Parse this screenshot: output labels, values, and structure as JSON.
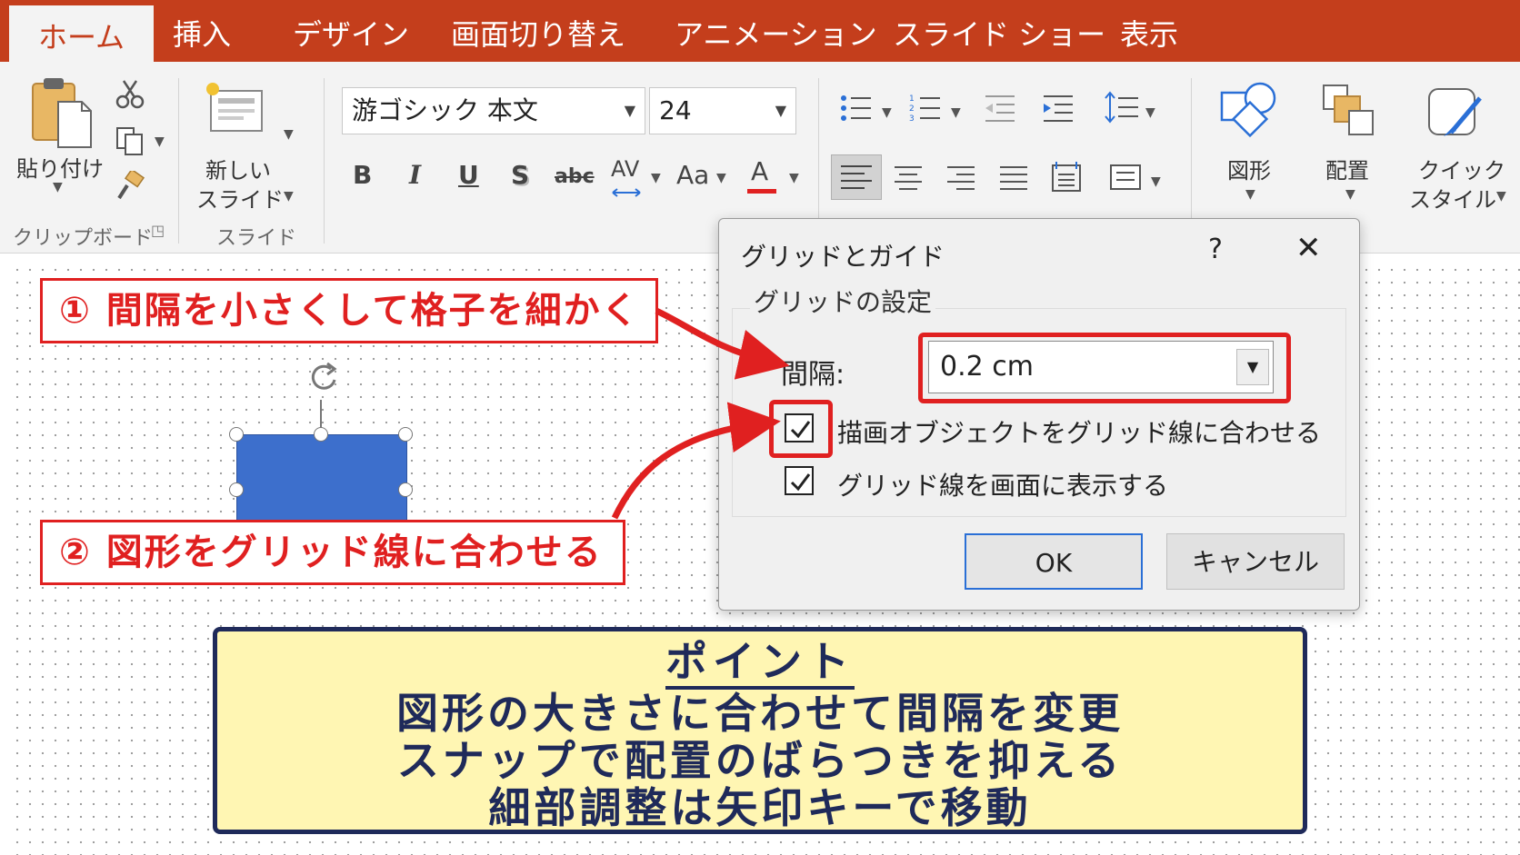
{
  "tabs": [
    {
      "label": "ホーム",
      "active": true
    },
    {
      "label": "挿入"
    },
    {
      "label": "デザイン"
    },
    {
      "label": "画面切り替え"
    },
    {
      "label": "アニメーション"
    },
    {
      "label": "スライド ショー"
    },
    {
      "label": "表示"
    }
  ],
  "ribbon": {
    "clipboard": {
      "paste_label": "貼り付け",
      "group_label": "クリップボード"
    },
    "slides": {
      "new_slide_line1": "新しい",
      "new_slide_line2": "スライド",
      "group_label": "スライド"
    },
    "font": {
      "name": "游ゴシック 本文",
      "size": "24",
      "bold": "B",
      "italic": "I",
      "underline": "U",
      "shadow": "S",
      "strike": "abc",
      "spacing": "AV",
      "case": "Aa",
      "color": "A"
    },
    "drawing": {
      "shapes_label": "図形",
      "arrange_label": "配置",
      "quick_line1": "クイック",
      "quick_line2": "スタイル"
    }
  },
  "colors": {
    "accent": "#c43e1c",
    "callout_red": "#e02020",
    "shape_blue": "#3d6fcc",
    "point_bg": "#fff6b3",
    "point_navy": "#1f2a5a"
  },
  "callouts": {
    "one": "① 間隔を小さくして格子を細かく",
    "two": "② 図形をグリッド線に合わせる"
  },
  "dialog": {
    "title": "グリッドとガイド",
    "help": "?",
    "close": "✕",
    "section": "グリッドの設定",
    "spacing_label": "間隔:",
    "spacing_value": "0.2 cm",
    "snap_label": "描画オブジェクトをグリッド線に合わせる",
    "snap_checked": true,
    "show_label": "グリッド線を画面に表示する",
    "show_checked": true,
    "ok": "OK",
    "cancel": "キャンセル"
  },
  "point": {
    "title": "ポイント",
    "lines": [
      "図形の大きさに合わせて間隔を変更",
      "スナップで配置のばらつきを抑える",
      "細部調整は矢印キーで移動"
    ]
  }
}
